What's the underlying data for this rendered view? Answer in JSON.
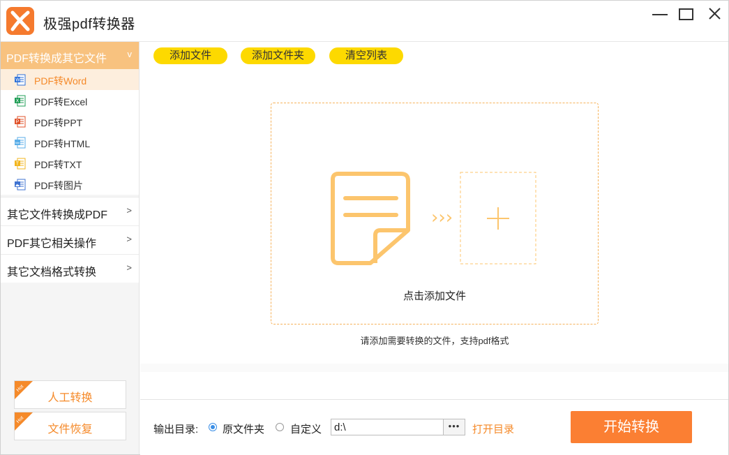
{
  "app": {
    "title": "极强pdf转换器"
  },
  "window_controls": {
    "minimize": "minimize-icon",
    "maximize": "maximize-icon",
    "close": "close-icon"
  },
  "sidebar": {
    "active_category": {
      "label": "PDF转换成其它文件",
      "chevron": "v"
    },
    "sub_items": [
      {
        "label": "PDF转Word",
        "icon": "word-icon",
        "color": "#2b6fd8",
        "active": true
      },
      {
        "label": "PDF转Excel",
        "icon": "excel-icon",
        "color": "#1f9d55"
      },
      {
        "label": "PDF转PPT",
        "icon": "ppt-icon",
        "color": "#e0522a"
      },
      {
        "label": "PDF转HTML",
        "icon": "html-icon",
        "color": "#5aaee8"
      },
      {
        "label": "PDF转TXT",
        "icon": "txt-icon",
        "color": "#f2b51c"
      },
      {
        "label": "PDF转图片",
        "icon": "image-icon",
        "color": "#3f73d1"
      }
    ],
    "categories": [
      {
        "label": "其它文件转换成PDF",
        "chevron": ">"
      },
      {
        "label": "PDF其它相关操作",
        "chevron": ">"
      },
      {
        "label": "其它文档格式转换",
        "chevron": ">"
      }
    ],
    "hot_buttons": [
      {
        "label": "人工转换",
        "badge": "Hot"
      },
      {
        "label": "文件恢复",
        "badge": "Hot"
      }
    ]
  },
  "toolbar": {
    "add_file": "添加文件",
    "add_folder": "添加文件夹",
    "clear_list": "清空列表"
  },
  "dropzone": {
    "hint": "点击添加文件",
    "arrows": "›››",
    "sub_hint": "请添加需要转换的文件，支持pdf格式"
  },
  "output": {
    "label": "输出目录:",
    "option_original": "原文件夹",
    "option_custom": "自定义",
    "selected": "原文件夹",
    "path_value": "d:\\",
    "browse": "•••",
    "open_dir": "打开目录"
  },
  "start_button": "开始转换",
  "colors": {
    "accent": "#fb7f33",
    "yellow": "#fdd900",
    "sidebar_active": "#f8c27f"
  }
}
